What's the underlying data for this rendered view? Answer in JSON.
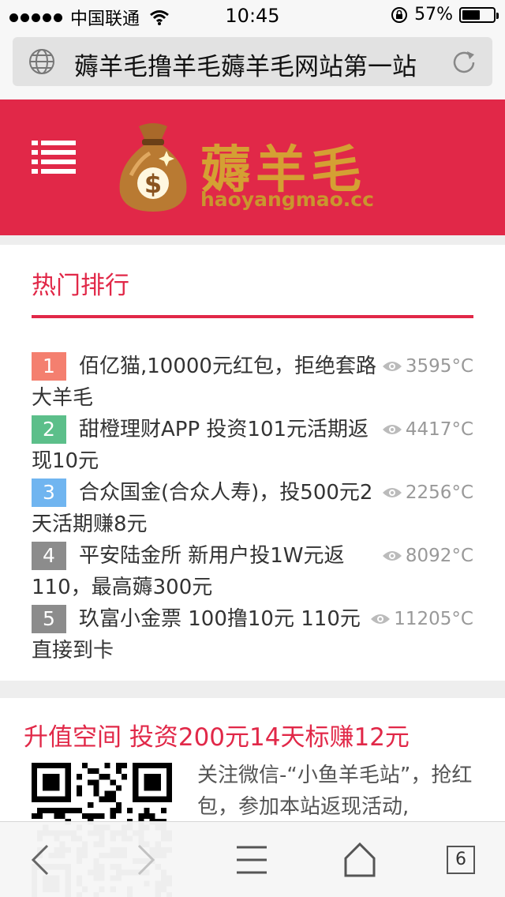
{
  "status_bar": {
    "carrier": "中国联通",
    "time": "10:45",
    "battery_percent": "57%",
    "battery_level": 0.57,
    "icons": [
      "signal-dots-icon",
      "wifi-icon",
      "rotation-lock-icon",
      "battery-icon"
    ]
  },
  "browser": {
    "page_title": "薅羊毛撸羊毛薅羊毛网站第一站",
    "icons": [
      "globe-icon",
      "reload-icon"
    ]
  },
  "header": {
    "logo_text": "薅羊毛",
    "logo_domain": "haoyangmao.cc",
    "icons": [
      "menu-icon",
      "money-bag-icon"
    ]
  },
  "hot_section": {
    "title": "热门排行",
    "items": [
      {
        "rank": "1",
        "text": "佰亿猫,10000元红包，拒绝套路 大羊毛",
        "views": "3595°C",
        "badge_color": "#f47f6f"
      },
      {
        "rank": "2",
        "text": "甜橙理财APP 投资101元活期返现10元",
        "views": "4417°C",
        "badge_color": "#5cbf8a"
      },
      {
        "rank": "3",
        "text": "合众国金(合众人寿)，投500元2天活期赚8元",
        "views": "2256°C",
        "badge_color": "#70b5f0"
      },
      {
        "rank": "4",
        "text": "平安陆金所 新用户投1W元返110，最高薅300元",
        "views": "8092°C",
        "badge_color": "#8c8c8c"
      },
      {
        "rank": "5",
        "text": "玖富小金票 100撸10元 110元直接到卡",
        "views": "11205°C",
        "badge_color": "#8c8c8c"
      }
    ]
  },
  "promo": {
    "title": "升值空间 投资200元14天标赚12元",
    "text": "关注微信-“小鱼羊毛站”，抢红包，参加本站返现活动,"
  },
  "toolbar": {
    "tabs_count": "6",
    "icons": [
      "back-icon",
      "forward-icon",
      "share-icon",
      "bookmarks-icon",
      "tabs-icon"
    ]
  },
  "colors": {
    "accent": "#e12848",
    "logo_gold": "#d4a033"
  }
}
